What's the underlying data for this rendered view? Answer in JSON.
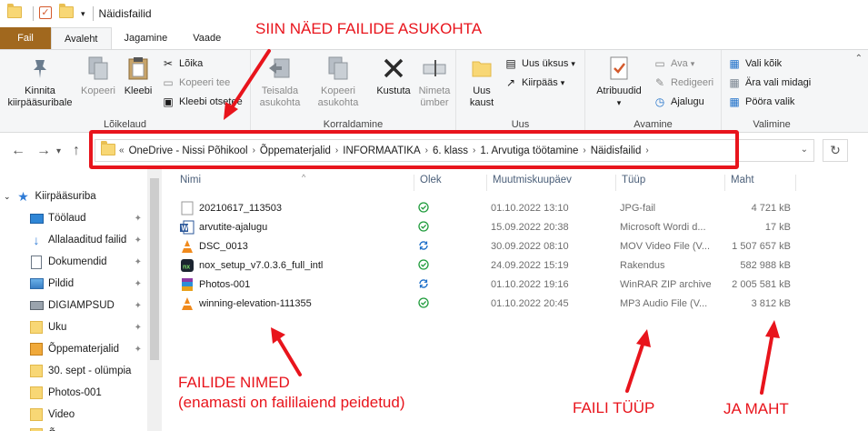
{
  "window": {
    "title": "Näidisfailid"
  },
  "tabs": {
    "file": "Fail",
    "items": [
      "Avaleht",
      "Jagamine",
      "Vaade"
    ]
  },
  "ribbon": {
    "groups": {
      "clipboard": "Lõikelaud",
      "organize": "Korraldamine",
      "new": "Uus",
      "open": "Avamine",
      "select": "Valimine"
    },
    "pin": "Kinnita\nkiirpääsuribale",
    "copy": "Kopeeri",
    "paste": "Kleebi",
    "cut": "Lõika",
    "copy_path": "Kopeeri tee",
    "paste_shortcut": "Kleebi otsetee",
    "move_to": "Teisalda\nasukohta",
    "copy_to": "Kopeeri\nasukohta",
    "delete": "Kustuta",
    "rename": "Nimeta\nümber",
    "new_folder": "Uus\nkaust",
    "new_item": "Uus üksus",
    "easy_access": "Kiirpääs",
    "properties": "Atribuudid",
    "open": "Ava",
    "edit": "Redigeeri",
    "history": "Ajalugu",
    "select_all": "Vali kõik",
    "select_none": "Ära vali midagi",
    "invert": "Pööra valik"
  },
  "address": {
    "prefix": "«",
    "crumbs": [
      "OneDrive - Nissi Põhikool",
      "Õppematerjalid",
      "INFORMAATIKA",
      "6. klass",
      "1. Arvutiga töötamine",
      "Näidisfailid"
    ]
  },
  "sidebar": {
    "items": [
      {
        "label": "Kiirpääsuriba",
        "icon": "star-icon",
        "pinned": false
      },
      {
        "label": "Töölaud",
        "icon": "desktop-icon",
        "pinned": true
      },
      {
        "label": "Allalaaditud failid",
        "icon": "download-icon",
        "pinned": true
      },
      {
        "label": "Dokumendid",
        "icon": "documents-icon",
        "pinned": true
      },
      {
        "label": "Pildid",
        "icon": "pictures-icon",
        "pinned": true
      },
      {
        "label": "DIGIAMPSUD",
        "icon": "drive-icon",
        "pinned": true
      },
      {
        "label": "Uku",
        "icon": "folder-icon",
        "pinned": true
      },
      {
        "label": "Õppematerjalid",
        "icon": "folder-icon",
        "pinned": true
      },
      {
        "label": "30. sept - olümpia",
        "icon": "folder-icon",
        "pinned": false
      },
      {
        "label": "Photos-001",
        "icon": "folder-icon",
        "pinned": false
      },
      {
        "label": "Video",
        "icon": "folder-icon",
        "pinned": false
      },
      {
        "label": "Õ",
        "icon": "folder-icon",
        "pinned": false
      }
    ]
  },
  "columns": {
    "name": "Nimi",
    "status": "Olek",
    "modified": "Muutmiskuupäev",
    "type": "Tüüp",
    "size": "Maht"
  },
  "files": [
    {
      "name": "20210617_113503",
      "icon": "image-file-icon",
      "status": "synced",
      "modified": "01.10.2022 13:10",
      "type": "JPG-fail",
      "size": "4 721 kB"
    },
    {
      "name": "arvutite-ajalugu",
      "icon": "word-file-icon",
      "status": "synced",
      "modified": "15.09.2022 20:38",
      "type": "Microsoft Wordi d...",
      "size": "17 kB"
    },
    {
      "name": "DSC_0013",
      "icon": "vlc-file-icon",
      "status": "syncing",
      "modified": "30.09.2022 08:10",
      "type": "MOV Video File (V...",
      "size": "1 507 657 kB"
    },
    {
      "name": "nox_setup_v7.0.3.6_full_intl",
      "icon": "app-file-icon",
      "status": "synced",
      "modified": "24.09.2022 15:19",
      "type": "Rakendus",
      "size": "582 988 kB"
    },
    {
      "name": "Photos-001",
      "icon": "winrar-file-icon",
      "status": "syncing",
      "modified": "01.10.2022 19:16",
      "type": "WinRAR ZIP archive",
      "size": "2 005 581 kB"
    },
    {
      "name": "winning-elevation-111355",
      "icon": "vlc-file-icon",
      "status": "synced",
      "modified": "01.10.2022 20:45",
      "type": "MP3 Audio File (V...",
      "size": "3 812 kB"
    }
  ],
  "annotations": {
    "location": "SIIN NÄED FAILIDE ASUKOHTA",
    "names_1": "FAILIDE NIMED",
    "names_2": "(enamasti on faililaiend peidetud)",
    "type": "FAILI TÜÜP",
    "size": "JA MAHT"
  },
  "colors": {
    "accent_red": "#e8141c",
    "file_tab": "#a1681e",
    "synced_green": "#1e9b3b",
    "syncing_blue": "#1d6fc9"
  }
}
